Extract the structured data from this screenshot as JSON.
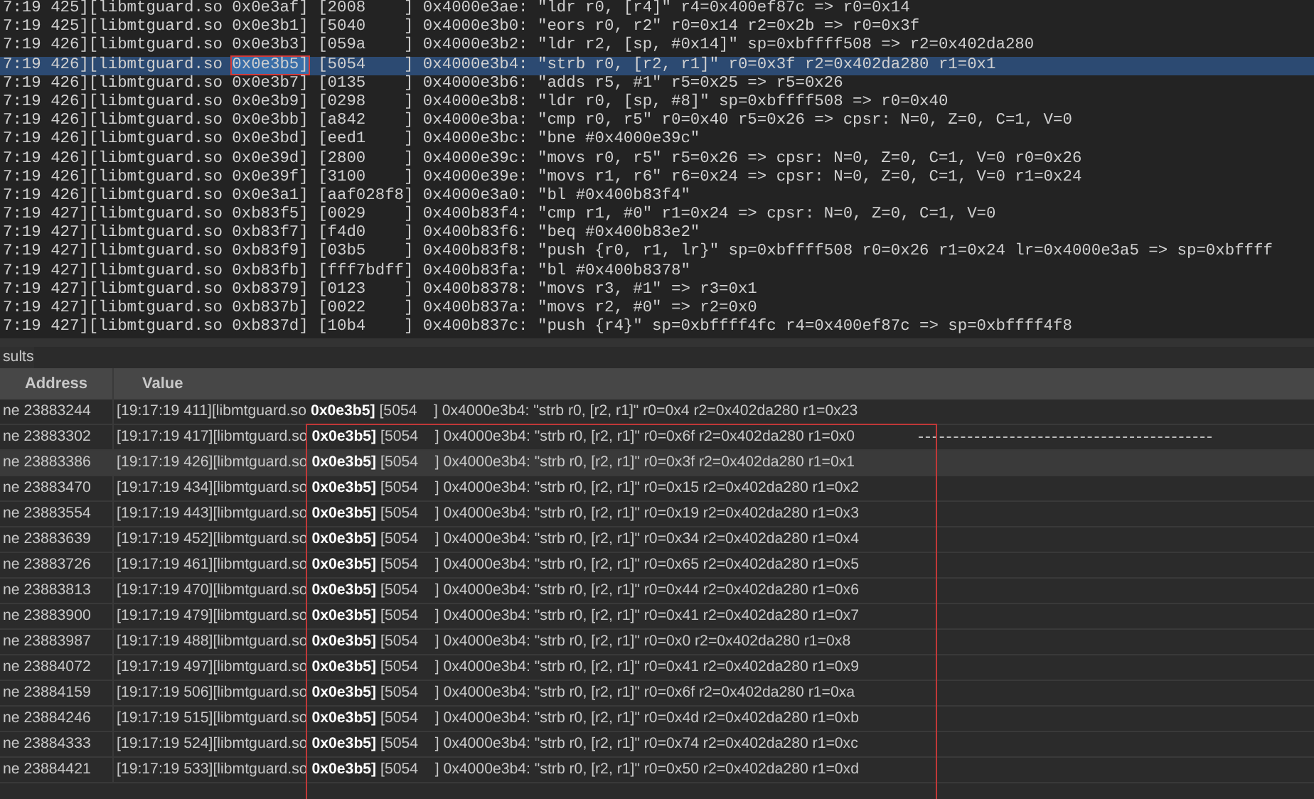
{
  "trace_log": {
    "lines": [
      {
        "prefix": "7:19 425][libmtguard.so ",
        "address": "0x0e3af]",
        "suffix": " [2008    ] 0x4000e3ae: \"ldr r0, [r4]\" r4=0x400ef87c => r0=0x14",
        "selected": false,
        "annotated": false
      },
      {
        "prefix": "7:19 425][libmtguard.so ",
        "address": "0x0e3b1]",
        "suffix": " [5040    ] 0x4000e3b0: \"eors r0, r2\" r0=0x14 r2=0x2b => r0=0x3f",
        "selected": false,
        "annotated": false
      },
      {
        "prefix": "7:19 426][libmtguard.so ",
        "address": "0x0e3b3]",
        "suffix": " [059a    ] 0x4000e3b2: \"ldr r2, [sp, #0x14]\" sp=0xbffff508 => r2=0x402da280",
        "selected": false,
        "annotated": false
      },
      {
        "prefix": "7:19 426][libmtguard.so ",
        "address": "0x0e3b5]",
        "suffix": " [5054    ] 0x4000e3b4: \"strb r0, [r2, r1]\" r0=0x3f r2=0x402da280 r1=0x1",
        "selected": true,
        "annotated": true
      },
      {
        "prefix": "7:19 426][libmtguard.so ",
        "address": "0x0e3b7]",
        "suffix": " [0135    ] 0x4000e3b6: \"adds r5, #1\" r5=0x25 => r5=0x26",
        "selected": false,
        "annotated": false
      },
      {
        "prefix": "7:19 426][libmtguard.so ",
        "address": "0x0e3b9]",
        "suffix": " [0298    ] 0x4000e3b8: \"ldr r0, [sp, #8]\" sp=0xbffff508 => r0=0x40",
        "selected": false,
        "annotated": false
      },
      {
        "prefix": "7:19 426][libmtguard.so ",
        "address": "0x0e3bb]",
        "suffix": " [a842    ] 0x4000e3ba: \"cmp r0, r5\" r0=0x40 r5=0x26 => cpsr: N=0, Z=0, C=1, V=0",
        "selected": false,
        "annotated": false
      },
      {
        "prefix": "7:19 426][libmtguard.so ",
        "address": "0x0e3bd]",
        "suffix": " [eed1    ] 0x4000e3bc: \"bne #0x4000e39c\"",
        "selected": false,
        "annotated": false
      },
      {
        "prefix": "7:19 426][libmtguard.so ",
        "address": "0x0e39d]",
        "suffix": " [2800    ] 0x4000e39c: \"movs r0, r5\" r5=0x26 => cpsr: N=0, Z=0, C=1, V=0 r0=0x26",
        "selected": false,
        "annotated": false
      },
      {
        "prefix": "7:19 426][libmtguard.so ",
        "address": "0x0e39f]",
        "suffix": " [3100    ] 0x4000e39e: \"movs r1, r6\" r6=0x24 => cpsr: N=0, Z=0, C=1, V=0 r1=0x24",
        "selected": false,
        "annotated": false
      },
      {
        "prefix": "7:19 426][libmtguard.so ",
        "address": "0x0e3a1]",
        "suffix": " [aaf028f8] 0x4000e3a0: \"bl #0x400b83f4\"",
        "selected": false,
        "annotated": false
      },
      {
        "prefix": "7:19 427][libmtguard.so ",
        "address": "0xb83f5]",
        "suffix": " [0029    ] 0x400b83f4: \"cmp r1, #0\" r1=0x24 => cpsr: N=0, Z=0, C=1, V=0",
        "selected": false,
        "annotated": false
      },
      {
        "prefix": "7:19 427][libmtguard.so ",
        "address": "0xb83f7]",
        "suffix": " [f4d0    ] 0x400b83f6: \"beq #0x400b83e2\"",
        "selected": false,
        "annotated": false
      },
      {
        "prefix": "7:19 427][libmtguard.so ",
        "address": "0xb83f9]",
        "suffix": " [03b5    ] 0x400b83f8: \"push {r0, r1, lr}\" sp=0xbffff508 r0=0x26 r1=0x24 lr=0x4000e3a5 => sp=0xbffff",
        "selected": false,
        "annotated": false
      },
      {
        "prefix": "7:19 427][libmtguard.so ",
        "address": "0xb83fb]",
        "suffix": " [fff7bdff] 0x400b83fa: \"bl #0x400b8378\"",
        "selected": false,
        "annotated": false
      },
      {
        "prefix": "7:19 427][libmtguard.so ",
        "address": "0xb8379]",
        "suffix": " [0123    ] 0x400b8378: \"movs r3, #1\" => r3=0x1",
        "selected": false,
        "annotated": false
      },
      {
        "prefix": "7:19 427][libmtguard.so ",
        "address": "0xb837b]",
        "suffix": " [0022    ] 0x400b837a: \"movs r2, #0\" => r2=0x0",
        "selected": false,
        "annotated": false
      },
      {
        "prefix": "7:19 427][libmtguard.so ",
        "address": "0xb837d]",
        "suffix": " [10b4    ] 0x400b837c: \"push {r4}\" sp=0xbffff4fc r4=0x400ef87c => sp=0xbffff4f8",
        "selected": false,
        "annotated": false
      }
    ]
  },
  "results": {
    "title": "sults",
    "columns": [
      "Address",
      "Value"
    ],
    "rows": [
      {
        "address": "ne 23883244",
        "value": "[19:17:19 411][libmtguard.so **0x0e3b5]** [5054    ] 0x4000e3b4: \"strb r0, [r2, r1]\" r0=0x4 r2=0x402da280 r1=0x23",
        "selected": false,
        "dashed": false
      },
      {
        "address": "ne 23883302",
        "value": "[19:17:19 417][libmtguard.so **0x0e3b5]** [5054    ] 0x4000e3b4: \"strb r0, [r2, r1]\" r0=0x6f r2=0x402da280 r1=0x0",
        "selected": false,
        "dashed": true
      },
      {
        "address": "ne 23883386",
        "value": "[19:17:19 426][libmtguard.so **0x0e3b5]** [5054    ] 0x4000e3b4: \"strb r0, [r2, r1]\" r0=0x3f r2=0x402da280 r1=0x1",
        "selected": true,
        "dashed": false
      },
      {
        "address": "ne 23883470",
        "value": "[19:17:19 434][libmtguard.so **0x0e3b5]** [5054    ] 0x4000e3b4: \"strb r0, [r2, r1]\" r0=0x15 r2=0x402da280 r1=0x2",
        "selected": false,
        "dashed": false
      },
      {
        "address": "ne 23883554",
        "value": "[19:17:19 443][libmtguard.so **0x0e3b5]** [5054    ] 0x4000e3b4: \"strb r0, [r2, r1]\" r0=0x19 r2=0x402da280 r1=0x3",
        "selected": false,
        "dashed": false
      },
      {
        "address": "ne 23883639",
        "value": "[19:17:19 452][libmtguard.so **0x0e3b5]** [5054    ] 0x4000e3b4: \"strb r0, [r2, r1]\" r0=0x34 r2=0x402da280 r1=0x4",
        "selected": false,
        "dashed": false
      },
      {
        "address": "ne 23883726",
        "value": "[19:17:19 461][libmtguard.so **0x0e3b5]** [5054    ] 0x4000e3b4: \"strb r0, [r2, r1]\" r0=0x65 r2=0x402da280 r1=0x5",
        "selected": false,
        "dashed": false
      },
      {
        "address": "ne 23883813",
        "value": "[19:17:19 470][libmtguard.so **0x0e3b5]** [5054    ] 0x4000e3b4: \"strb r0, [r2, r1]\" r0=0x44 r2=0x402da280 r1=0x6",
        "selected": false,
        "dashed": false
      },
      {
        "address": "ne 23883900",
        "value": "[19:17:19 479][libmtguard.so **0x0e3b5]** [5054    ] 0x4000e3b4: \"strb r0, [r2, r1]\" r0=0x41 r2=0x402da280 r1=0x7",
        "selected": false,
        "dashed": false
      },
      {
        "address": "ne 23883987",
        "value": "[19:17:19 488][libmtguard.so **0x0e3b5]** [5054    ] 0x4000e3b4: \"strb r0, [r2, r1]\" r0=0x0 r2=0x402da280 r1=0x8",
        "selected": false,
        "dashed": false
      },
      {
        "address": "ne 23884072",
        "value": "[19:17:19 497][libmtguard.so **0x0e3b5]** [5054    ] 0x4000e3b4: \"strb r0, [r2, r1]\" r0=0x41 r2=0x402da280 r1=0x9",
        "selected": false,
        "dashed": false
      },
      {
        "address": "ne 23884159",
        "value": "[19:17:19 506][libmtguard.so **0x0e3b5]** [5054    ] 0x4000e3b4: \"strb r0, [r2, r1]\" r0=0x6f r2=0x402da280 r1=0xa",
        "selected": false,
        "dashed": false
      },
      {
        "address": "ne 23884246",
        "value": "[19:17:19 515][libmtguard.so **0x0e3b5]** [5054    ] 0x4000e3b4: \"strb r0, [r2, r1]\" r0=0x4d r2=0x402da280 r1=0xb",
        "selected": false,
        "dashed": false
      },
      {
        "address": "ne 23884333",
        "value": "[19:17:19 524][libmtguard.so **0x0e3b5]** [5054    ] 0x4000e3b4: \"strb r0, [r2, r1]\" r0=0x74 r2=0x402da280 r1=0xc",
        "selected": false,
        "dashed": false
      },
      {
        "address": "ne 23884421",
        "value": "[19:17:19 533][libmtguard.so **0x0e3b5]** [5054    ] 0x4000e3b4: \"strb r0, [r2, r1]\" r0=0x50 r2=0x402da280 r1=0xd",
        "selected": false,
        "dashed": false
      }
    ]
  }
}
